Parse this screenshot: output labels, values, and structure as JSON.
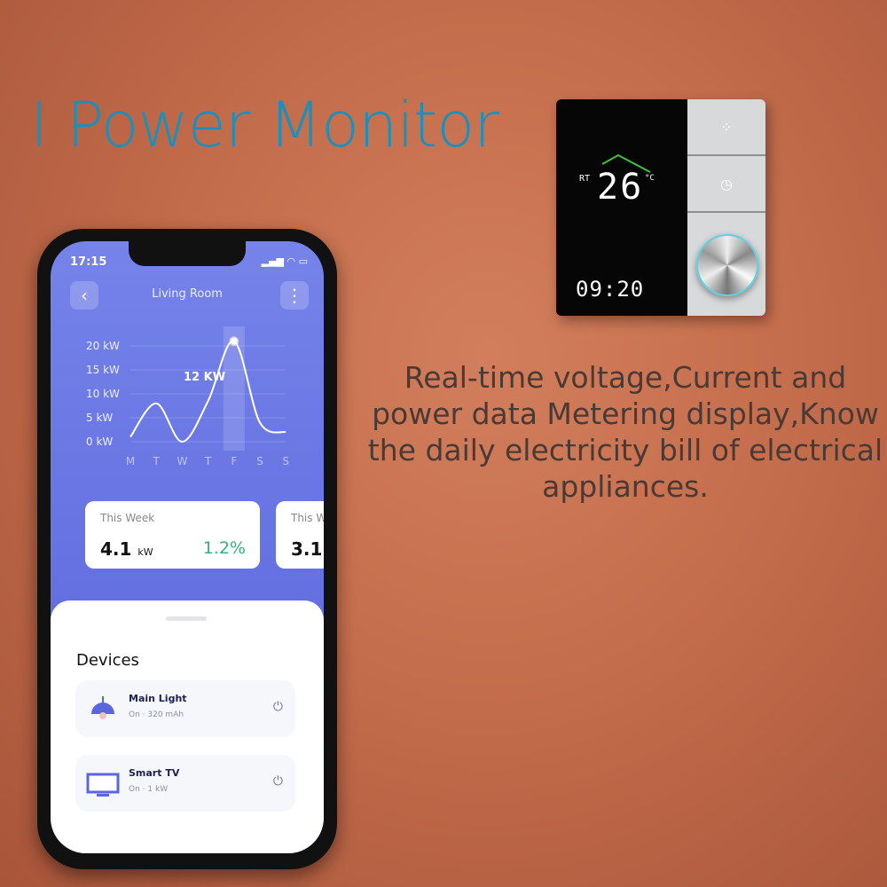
{
  "headline": "I Power Monitor",
  "description": "Real-time voltage,Current and power data Metering display,Know the daily electricity bill of electrical appliances.",
  "thermostat": {
    "rt_label": "RT",
    "temperature": "26",
    "unit": "°C",
    "clock": "09:20"
  },
  "phone": {
    "status_time": "17:15",
    "title": "Living Room",
    "chart_data": {
      "type": "line",
      "categories": [
        "M",
        "T",
        "W",
        "T",
        "F",
        "S",
        "S"
      ],
      "values": [
        1,
        8,
        0,
        8.5,
        21,
        4,
        2
      ],
      "y_ticks": [
        "20 kW",
        "15 kW",
        "10 kW",
        "5 kW",
        "0 kW"
      ],
      "ylim": [
        0,
        20
      ],
      "highlight": "F",
      "annotation": "12 KW",
      "color": "#ffffff"
    },
    "cards": [
      {
        "label": "This Week",
        "value": "4.1",
        "unit": "kW",
        "change": "1.2%"
      },
      {
        "label": "This W",
        "value": "3.1"
      }
    ],
    "devices_title": "Devices",
    "devices": [
      {
        "name": "Main Light",
        "status": "On",
        "detail": "320 mAh",
        "icon": "lamp-icon"
      },
      {
        "name": "Smart TV",
        "status": "On",
        "detail": "1 kW",
        "icon": "tv-icon"
      }
    ],
    "accent": "#6470e0",
    "positive": "#2fb37d"
  }
}
